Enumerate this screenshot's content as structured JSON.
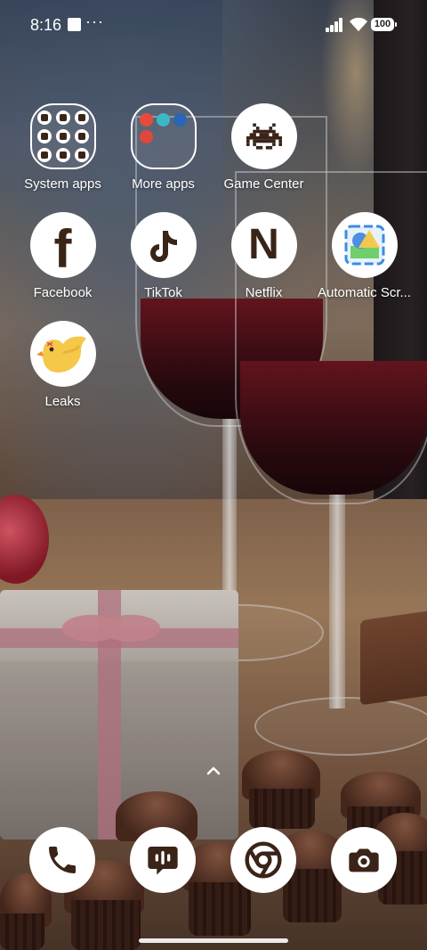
{
  "status_bar": {
    "time": "8:16",
    "overflow": "···",
    "battery": "100"
  },
  "apps": {
    "system_apps": {
      "label": "System apps"
    },
    "more_apps": {
      "label": "More apps"
    },
    "game_center": {
      "label": "Game Center"
    },
    "facebook": {
      "label": "Facebook",
      "glyph": "f"
    },
    "tiktok": {
      "label": "TikTok"
    },
    "netflix": {
      "label": "Netflix",
      "glyph": "N"
    },
    "automatic_scroll": {
      "label": "Automatic Scr..."
    },
    "leaks": {
      "label": "Leaks"
    }
  },
  "dock": {
    "items": [
      "phone-icon",
      "messages-icon",
      "chrome-icon",
      "camera-icon"
    ]
  },
  "colors": {
    "icon_fg": "#3a2418",
    "icon_bg": "#ffffff"
  }
}
